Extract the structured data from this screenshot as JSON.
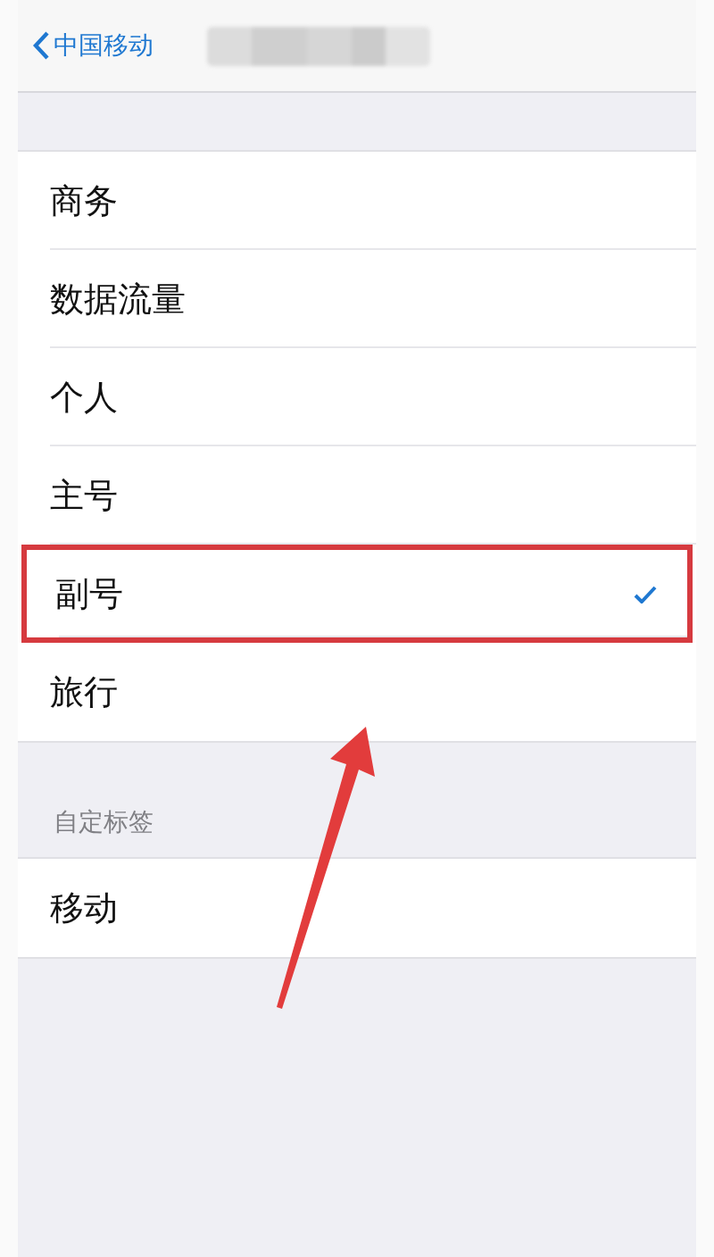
{
  "nav": {
    "back_label": "中国移动"
  },
  "labels": [
    {
      "label": "商务",
      "selected": false,
      "annotated": false
    },
    {
      "label": "数据流量",
      "selected": false,
      "annotated": false
    },
    {
      "label": "个人",
      "selected": false,
      "annotated": false
    },
    {
      "label": "主号",
      "selected": false,
      "annotated": false
    },
    {
      "label": "副号",
      "selected": true,
      "annotated": true
    },
    {
      "label": "旅行",
      "selected": false,
      "annotated": false
    }
  ],
  "custom_section": {
    "header": "自定标签",
    "items": [
      {
        "label": "移动",
        "selected": false,
        "annotated": false
      }
    ]
  }
}
